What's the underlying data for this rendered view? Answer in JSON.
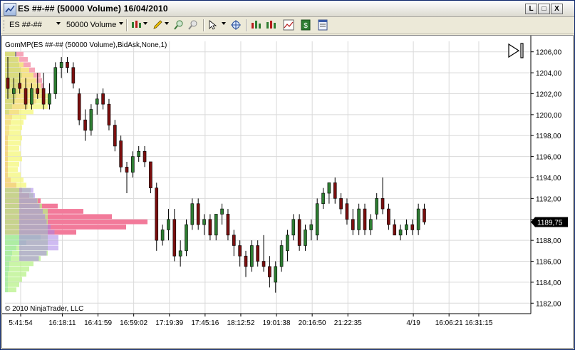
{
  "window": {
    "title": "ES ##-## (50000 Volume)  16/04/2010",
    "buttons": {
      "minimize": "L",
      "restore": "□",
      "close": "X"
    }
  },
  "toolbar": {
    "instrument": "ES ##-##",
    "period": "50000 Volume",
    "icons": [
      "bar-style-icon",
      "draw-pencil-icon",
      "zoom-in-icon",
      "zoom-out-icon",
      "pointer-icon",
      "crosshair-icon",
      "strategies-icon",
      "indicators-icon",
      "data-series-icon",
      "money-icon",
      "properties-icon"
    ]
  },
  "chart": {
    "indicator_label": "GomMP(ES ##-## (50000 Volume),BidAsk,None,1)",
    "copyright": "© 2010 NinjaTrader, LLC",
    "current_price_label": "1189,75",
    "colors": {
      "up_candle": "#2e7d32",
      "down_candle": "#7a0e0e",
      "price_marker": "#000000",
      "grid": "#d9d9d9"
    }
  },
  "chart_data": {
    "type": "candlestick",
    "y_axis": {
      "ylim": [
        1181,
        1207
      ],
      "tick_labels": [
        "1206,00",
        "1204,00",
        "1202,00",
        "1200,00",
        "1198,00",
        "1196,00",
        "1194,00",
        "1192,00",
        "1190,00",
        "1188,00",
        "1186,00",
        "1184,00",
        "1182,00"
      ],
      "tick_values": [
        1206,
        1204,
        1202,
        1200,
        1198,
        1196,
        1194,
        1192,
        1190,
        1188,
        1186,
        1184,
        1182
      ]
    },
    "x_axis": {
      "tick_labels": [
        "5:41:54",
        "16:18:11",
        "16:41:59",
        "16:59:02",
        "17:19:39",
        "17:45:16",
        "18:12:52",
        "19:01:38",
        "20:16:50",
        "21:22:35",
        "4/19",
        "16:06:21",
        "16:31:15"
      ],
      "tick_bar_index": [
        0,
        7,
        13,
        19,
        25,
        31,
        37,
        43,
        49,
        55,
        66,
        72,
        77
      ]
    },
    "current_price": 1189.75,
    "bars": [
      {
        "o": 1203.5,
        "h": 1205.5,
        "l": 1201.5,
        "c": 1202.5
      },
      {
        "o": 1202.0,
        "h": 1203.5,
        "l": 1201.0,
        "c": 1202.5
      },
      {
        "o": 1203.0,
        "h": 1204.0,
        "l": 1202.0,
        "c": 1202.5
      },
      {
        "o": 1202.5,
        "h": 1203.5,
        "l": 1200.5,
        "c": 1201.0
      },
      {
        "o": 1201.0,
        "h": 1203.0,
        "l": 1200.5,
        "c": 1202.5
      },
      {
        "o": 1202.5,
        "h": 1204.0,
        "l": 1201.5,
        "c": 1202.0
      },
      {
        "o": 1202.5,
        "h": 1204.0,
        "l": 1200.5,
        "c": 1201.0
      },
      {
        "o": 1201.0,
        "h": 1203.0,
        "l": 1200.5,
        "c": 1202.0
      },
      {
        "o": 1202.0,
        "h": 1205.0,
        "l": 1201.5,
        "c": 1204.5
      },
      {
        "o": 1204.5,
        "h": 1205.5,
        "l": 1203.5,
        "c": 1205.0
      },
      {
        "o": 1205.0,
        "h": 1205.5,
        "l": 1204.0,
        "c": 1204.5
      },
      {
        "o": 1204.5,
        "h": 1205.0,
        "l": 1202.5,
        "c": 1203.0
      },
      {
        "o": 1202.0,
        "h": 1202.5,
        "l": 1199.0,
        "c": 1199.5
      },
      {
        "o": 1199.5,
        "h": 1200.5,
        "l": 1197.5,
        "c": 1198.5
      },
      {
        "o": 1198.5,
        "h": 1201.0,
        "l": 1198.0,
        "c": 1200.5
      },
      {
        "o": 1201.0,
        "h": 1202.0,
        "l": 1200.0,
        "c": 1201.5
      },
      {
        "o": 1202.0,
        "h": 1202.5,
        "l": 1200.5,
        "c": 1201.0
      },
      {
        "o": 1201.0,
        "h": 1201.5,
        "l": 1198.5,
        "c": 1199.0
      },
      {
        "o": 1199.0,
        "h": 1199.5,
        "l": 1196.5,
        "c": 1197.0
      },
      {
        "o": 1197.5,
        "h": 1198.0,
        "l": 1194.5,
        "c": 1195.0
      },
      {
        "o": 1195.0,
        "h": 1195.5,
        "l": 1192.5,
        "c": 1194.5
      },
      {
        "o": 1194.5,
        "h": 1196.5,
        "l": 1194.0,
        "c": 1196.0
      },
      {
        "o": 1196.0,
        "h": 1197.0,
        "l": 1195.5,
        "c": 1196.5
      },
      {
        "o": 1196.5,
        "h": 1197.0,
        "l": 1195.0,
        "c": 1195.5
      },
      {
        "o": 1195.5,
        "h": 1195.5,
        "l": 1192.5,
        "c": 1193.0
      },
      {
        "o": 1193.0,
        "h": 1193.5,
        "l": 1187.0,
        "c": 1188.0
      },
      {
        "o": 1188.0,
        "h": 1189.5,
        "l": 1187.5,
        "c": 1189.0
      },
      {
        "o": 1189.0,
        "h": 1191.0,
        "l": 1188.0,
        "c": 1190.0
      },
      {
        "o": 1190.0,
        "h": 1191.0,
        "l": 1186.0,
        "c": 1186.5
      },
      {
        "o": 1186.5,
        "h": 1188.0,
        "l": 1185.5,
        "c": 1187.0
      },
      {
        "o": 1187.0,
        "h": 1190.0,
        "l": 1186.5,
        "c": 1189.5
      },
      {
        "o": 1189.5,
        "h": 1192.0,
        "l": 1189.0,
        "c": 1191.5
      },
      {
        "o": 1191.5,
        "h": 1192.0,
        "l": 1189.0,
        "c": 1189.5
      },
      {
        "o": 1189.5,
        "h": 1190.5,
        "l": 1188.5,
        "c": 1190.0
      },
      {
        "o": 1190.0,
        "h": 1190.5,
        "l": 1188.0,
        "c": 1188.5
      },
      {
        "o": 1188.5,
        "h": 1190.5,
        "l": 1188.0,
        "c": 1190.5
      },
      {
        "o": 1190.5,
        "h": 1191.5,
        "l": 1189.5,
        "c": 1191.0
      },
      {
        "o": 1190.5,
        "h": 1191.0,
        "l": 1188.0,
        "c": 1188.5
      },
      {
        "o": 1188.5,
        "h": 1189.0,
        "l": 1186.5,
        "c": 1187.5
      },
      {
        "o": 1187.5,
        "h": 1188.0,
        "l": 1185.5,
        "c": 1186.5
      },
      {
        "o": 1186.5,
        "h": 1187.0,
        "l": 1184.5,
        "c": 1185.5
      },
      {
        "o": 1185.5,
        "h": 1188.0,
        "l": 1185.0,
        "c": 1187.5
      },
      {
        "o": 1187.5,
        "h": 1188.0,
        "l": 1185.5,
        "c": 1186.0
      },
      {
        "o": 1186.0,
        "h": 1188.5,
        "l": 1185.0,
        "c": 1185.5
      },
      {
        "o": 1185.5,
        "h": 1186.5,
        "l": 1183.5,
        "c": 1184.5
      },
      {
        "o": 1184.0,
        "h": 1186.0,
        "l": 1183.0,
        "c": 1185.5
      },
      {
        "o": 1185.5,
        "h": 1188.0,
        "l": 1185.0,
        "c": 1187.5
      },
      {
        "o": 1187.0,
        "h": 1189.0,
        "l": 1186.0,
        "c": 1188.5
      },
      {
        "o": 1188.5,
        "h": 1190.5,
        "l": 1188.0,
        "c": 1190.0
      },
      {
        "o": 1190.0,
        "h": 1190.5,
        "l": 1187.0,
        "c": 1187.5
      },
      {
        "o": 1187.5,
        "h": 1189.5,
        "l": 1187.0,
        "c": 1189.0
      },
      {
        "o": 1189.0,
        "h": 1190.0,
        "l": 1188.0,
        "c": 1189.5
      },
      {
        "o": 1188.5,
        "h": 1192.0,
        "l": 1188.0,
        "c": 1191.5
      },
      {
        "o": 1191.5,
        "h": 1193.0,
        "l": 1191.0,
        "c": 1192.5
      },
      {
        "o": 1192.5,
        "h": 1193.5,
        "l": 1191.5,
        "c": 1193.5
      },
      {
        "o": 1193.5,
        "h": 1194.0,
        "l": 1191.5,
        "c": 1192.0
      },
      {
        "o": 1192.0,
        "h": 1192.5,
        "l": 1190.5,
        "c": 1191.0
      },
      {
        "o": 1191.5,
        "h": 1192.0,
        "l": 1189.5,
        "c": 1190.0
      },
      {
        "o": 1190.0,
        "h": 1191.0,
        "l": 1188.5,
        "c": 1189.0
      },
      {
        "o": 1189.0,
        "h": 1191.5,
        "l": 1188.5,
        "c": 1191.0
      },
      {
        "o": 1191.0,
        "h": 1191.5,
        "l": 1188.5,
        "c": 1189.0
      },
      {
        "o": 1189.0,
        "h": 1190.5,
        "l": 1188.5,
        "c": 1190.0
      },
      {
        "o": 1190.5,
        "h": 1192.5,
        "l": 1190.0,
        "c": 1192.0
      },
      {
        "o": 1192.0,
        "h": 1194.0,
        "l": 1190.5,
        "c": 1191.0
      },
      {
        "o": 1191.0,
        "h": 1191.5,
        "l": 1189.0,
        "c": 1189.5
      },
      {
        "o": 1189.5,
        "h": 1190.0,
        "l": 1188.5,
        "c": 1188.5
      },
      {
        "o": 1188.5,
        "h": 1189.5,
        "l": 1188.0,
        "c": 1189.0
      },
      {
        "o": 1189.0,
        "h": 1190.0,
        "l": 1188.5,
        "c": 1189.5
      },
      {
        "o": 1189.5,
        "h": 1190.0,
        "l": 1188.5,
        "c": 1189.0
      },
      {
        "o": 1189.0,
        "h": 1191.5,
        "l": 1188.5,
        "c": 1191.0
      },
      {
        "o": 1191.0,
        "h": 1191.5,
        "l": 1189.5,
        "c": 1189.75
      }
    ],
    "profile": [
      {
        "p": 1205.75,
        "g": 16,
        "r": 10,
        "y": 14
      },
      {
        "p": 1205.25,
        "g": 18,
        "r": 14,
        "y": 20
      },
      {
        "p": 1204.75,
        "g": 20,
        "r": 16,
        "y": 26
      },
      {
        "p": 1204.25,
        "g": 22,
        "r": 20,
        "y": 34
      },
      {
        "p": 1203.75,
        "g": 24,
        "r": 26,
        "y": 40
      },
      {
        "p": 1203.25,
        "g": 22,
        "r": 30,
        "y": 44
      },
      {
        "p": 1202.75,
        "g": 20,
        "r": 34,
        "y": 50
      },
      {
        "p": 1202.25,
        "g": 18,
        "r": 36,
        "y": 56
      },
      {
        "p": 1201.75,
        "g": 16,
        "r": 36,
        "y": 60
      },
      {
        "p": 1201.25,
        "g": 14,
        "r": 30,
        "y": 64
      },
      {
        "p": 1200.75,
        "g": 10,
        "r": 22,
        "y": 60
      },
      {
        "p": 1200.25,
        "g": 6,
        "r": 14,
        "y": 40
      },
      {
        "p": 1199.75,
        "g": 0,
        "r": 10,
        "y": 30
      },
      {
        "p": 1199.25,
        "g": 0,
        "r": 8,
        "y": 26
      },
      {
        "p": 1198.75,
        "g": 0,
        "r": 6,
        "y": 24
      },
      {
        "p": 1198.25,
        "g": 0,
        "r": 6,
        "y": 22
      },
      {
        "p": 1197.75,
        "g": 0,
        "r": 4,
        "y": 24
      },
      {
        "p": 1197.25,
        "g": 0,
        "r": 4,
        "y": 22
      },
      {
        "p": 1196.75,
        "g": 0,
        "r": 4,
        "y": 20
      },
      {
        "p": 1196.25,
        "g": 0,
        "r": 4,
        "y": 22
      },
      {
        "p": 1195.75,
        "g": 0,
        "r": 4,
        "y": 24
      },
      {
        "p": 1195.25,
        "g": 0,
        "r": 4,
        "y": 20
      },
      {
        "p": 1194.75,
        "g": 0,
        "r": 4,
        "y": 18
      },
      {
        "p": 1194.25,
        "g": 0,
        "r": 4,
        "y": 22
      },
      {
        "p": 1193.75,
        "g": 0,
        "r": 8,
        "y": 26
      },
      {
        "p": 1193.25,
        "g": 0,
        "r": 16,
        "y": 30
      },
      {
        "p": 1192.75,
        "g": 0,
        "r": 24,
        "y": 36
      },
      {
        "p": 1192.25,
        "g": 0,
        "r": 34,
        "y": 40
      },
      {
        "p": 1191.75,
        "g": 0,
        "r": 50,
        "y": 46
      },
      {
        "p": 1191.25,
        "g": 0,
        "r": 74,
        "y": 52
      },
      {
        "p": 1190.75,
        "g": 0,
        "r": 110,
        "y": 60
      },
      {
        "p": 1190.25,
        "g": 0,
        "r": 150,
        "y": 66
      },
      {
        "p": 1189.75,
        "g": 0,
        "r": 200,
        "y": 70
      },
      {
        "p": 1189.25,
        "g": 0,
        "r": 170,
        "y": 80
      },
      {
        "p": 1188.75,
        "g": 0,
        "r": 100,
        "y": 90
      },
      {
        "p": 1188.25,
        "g": 0,
        "r": 50,
        "y": 100
      },
      {
        "p": 1187.75,
        "g": 0,
        "r": 30,
        "y": 110
      },
      {
        "p": 1187.25,
        "g": 0,
        "r": 16,
        "y": 104
      },
      {
        "p": 1186.75,
        "g": 0,
        "r": 10,
        "y": 70
      },
      {
        "p": 1186.25,
        "g": 0,
        "r": 8,
        "y": 50
      },
      {
        "p": 1185.75,
        "g": 0,
        "r": 6,
        "y": 40
      },
      {
        "p": 1185.25,
        "g": 0,
        "r": 6,
        "y": 34
      },
      {
        "p": 1184.75,
        "g": 0,
        "r": 4,
        "y": 30
      },
      {
        "p": 1184.25,
        "g": 0,
        "r": 4,
        "y": 24
      },
      {
        "p": 1183.75,
        "g": 0,
        "r": 4,
        "y": 20
      },
      {
        "p": 1183.25,
        "g": 0,
        "r": 4,
        "y": 16
      }
    ]
  }
}
